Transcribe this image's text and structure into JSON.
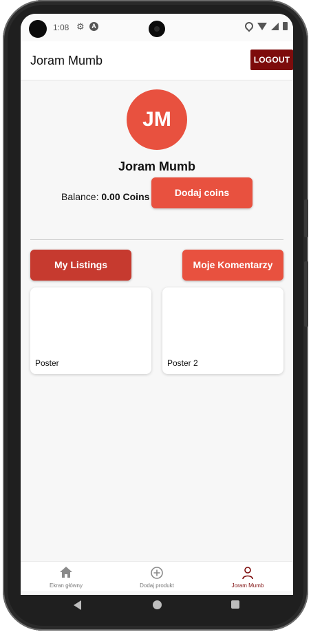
{
  "status_bar": {
    "time": "1:08"
  },
  "header": {
    "title": "Joram Mumb",
    "logout_label": "LOGOUT"
  },
  "profile": {
    "initials": "JM",
    "name": "Joram Mumb",
    "balance_label": "Balance:",
    "balance_value": "0.00 Coins",
    "add_coins_label": "Dodaj coins"
  },
  "tabs": [
    {
      "label": "My Listings",
      "active": true
    },
    {
      "label": "Moje Komentarzy",
      "active": false
    }
  ],
  "listings": [
    {
      "title": "Poster"
    },
    {
      "title": "Poster 2"
    }
  ],
  "bottom_nav": [
    {
      "label": "Ekran główny",
      "icon": "home-icon"
    },
    {
      "label": "Dodaj produkt",
      "icon": "plus-circle-icon"
    },
    {
      "label": "Joram Mumb",
      "icon": "person-icon",
      "active": true
    }
  ],
  "colors": {
    "accent": "#e8513f",
    "accent_dark": "#c63a2f",
    "logout": "#7d0c0c"
  }
}
